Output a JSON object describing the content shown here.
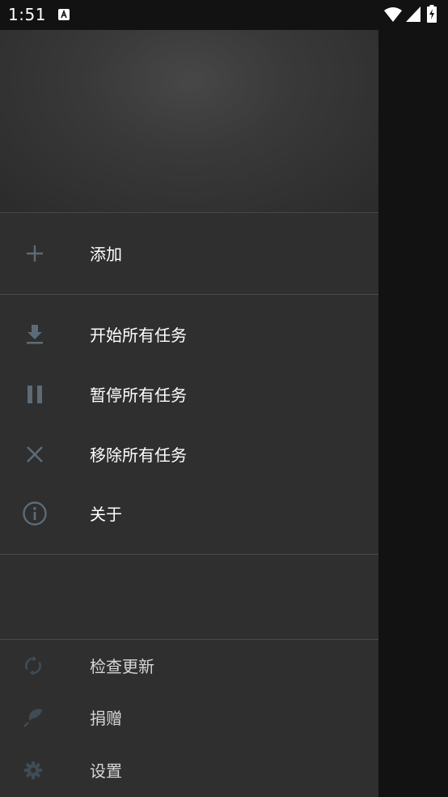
{
  "status_bar": {
    "time": "1:51",
    "notification_icon": "a-icon",
    "icons": [
      "wifi-icon",
      "signal-icon",
      "battery-charging-icon"
    ]
  },
  "drawer": {
    "items_top": [
      {
        "icon": "plus-icon",
        "label": "添加"
      }
    ],
    "items_tasks": [
      {
        "icon": "download-icon",
        "label": "开始所有任务"
      },
      {
        "icon": "pause-icon",
        "label": "暂停所有任务"
      },
      {
        "icon": "close-icon",
        "label": "移除所有任务"
      },
      {
        "icon": "info-icon",
        "label": "关于"
      }
    ],
    "items_bottom": [
      {
        "icon": "sync-icon",
        "label": "检查更新"
      },
      {
        "icon": "donate-icon",
        "label": "捐赠"
      },
      {
        "icon": "gear-icon",
        "label": "设置"
      }
    ]
  },
  "colors": {
    "icon": "#5b6b78",
    "drawer_bg": "#2f2f2f",
    "scrim": "#121212",
    "text": "#ffffff"
  }
}
